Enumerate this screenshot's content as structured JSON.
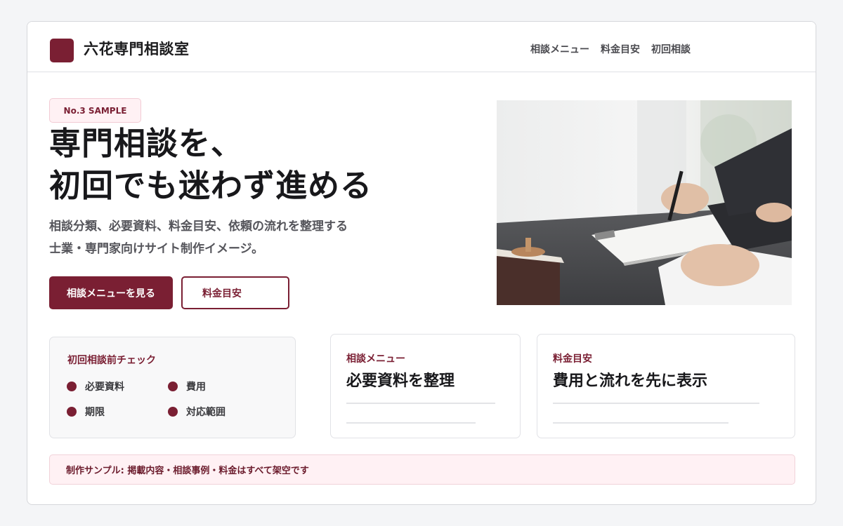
{
  "brand": {
    "name": "六花専門相談室"
  },
  "nav": {
    "items": [
      "相談メニュー",
      "料金目安",
      "初回相談"
    ]
  },
  "hero": {
    "badge": "No.3 SAMPLE",
    "headline_line1": "専門相談を、",
    "headline_line2": "初回でも迷わず進める",
    "sub_line1": "相談分類、必要資料、料金目安、依頼の流れを整理する",
    "sub_line2": "士業・専門家向けサイト制作イメージ。",
    "primary_button": "相談メニューを見る",
    "secondary_button": "料金目安"
  },
  "check_card": {
    "title": "初回相談前チェック",
    "items": [
      "必要資料",
      "費用",
      "期限",
      "対応範囲"
    ]
  },
  "menu_card": {
    "label": "相談メニュー",
    "title": "必要資料を整理"
  },
  "fee_card": {
    "label": "料金目安",
    "title": "費用と流れを先に表示"
  },
  "notice": "制作サンプル: 掲載内容・相談事例・料金はすべて架空です",
  "colors": {
    "accent": "#7a1f33",
    "accent_soft": "#fff1f4",
    "background": "#f4f5f7"
  },
  "photo": {
    "subject": "hand-signing-document-photo"
  }
}
